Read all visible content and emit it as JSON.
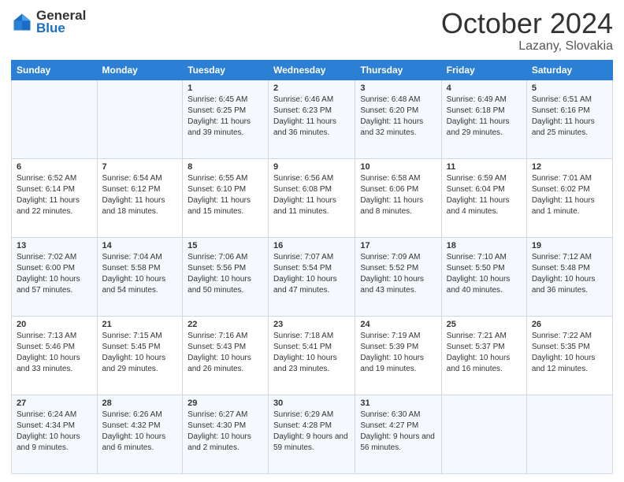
{
  "header": {
    "logo_general": "General",
    "logo_blue": "Blue",
    "month_title": "October 2024",
    "location": "Lazany, Slovakia"
  },
  "days_of_week": [
    "Sunday",
    "Monday",
    "Tuesday",
    "Wednesday",
    "Thursday",
    "Friday",
    "Saturday"
  ],
  "weeks": [
    [
      {
        "day": "",
        "sunrise": "",
        "sunset": "",
        "daylight": ""
      },
      {
        "day": "",
        "sunrise": "",
        "sunset": "",
        "daylight": ""
      },
      {
        "day": "1",
        "sunrise": "Sunrise: 6:45 AM",
        "sunset": "Sunset: 6:25 PM",
        "daylight": "Daylight: 11 hours and 39 minutes."
      },
      {
        "day": "2",
        "sunrise": "Sunrise: 6:46 AM",
        "sunset": "Sunset: 6:23 PM",
        "daylight": "Daylight: 11 hours and 36 minutes."
      },
      {
        "day": "3",
        "sunrise": "Sunrise: 6:48 AM",
        "sunset": "Sunset: 6:20 PM",
        "daylight": "Daylight: 11 hours and 32 minutes."
      },
      {
        "day": "4",
        "sunrise": "Sunrise: 6:49 AM",
        "sunset": "Sunset: 6:18 PM",
        "daylight": "Daylight: 11 hours and 29 minutes."
      },
      {
        "day": "5",
        "sunrise": "Sunrise: 6:51 AM",
        "sunset": "Sunset: 6:16 PM",
        "daylight": "Daylight: 11 hours and 25 minutes."
      }
    ],
    [
      {
        "day": "6",
        "sunrise": "Sunrise: 6:52 AM",
        "sunset": "Sunset: 6:14 PM",
        "daylight": "Daylight: 11 hours and 22 minutes."
      },
      {
        "day": "7",
        "sunrise": "Sunrise: 6:54 AM",
        "sunset": "Sunset: 6:12 PM",
        "daylight": "Daylight: 11 hours and 18 minutes."
      },
      {
        "day": "8",
        "sunrise": "Sunrise: 6:55 AM",
        "sunset": "Sunset: 6:10 PM",
        "daylight": "Daylight: 11 hours and 15 minutes."
      },
      {
        "day": "9",
        "sunrise": "Sunrise: 6:56 AM",
        "sunset": "Sunset: 6:08 PM",
        "daylight": "Daylight: 11 hours and 11 minutes."
      },
      {
        "day": "10",
        "sunrise": "Sunrise: 6:58 AM",
        "sunset": "Sunset: 6:06 PM",
        "daylight": "Daylight: 11 hours and 8 minutes."
      },
      {
        "day": "11",
        "sunrise": "Sunrise: 6:59 AM",
        "sunset": "Sunset: 6:04 PM",
        "daylight": "Daylight: 11 hours and 4 minutes."
      },
      {
        "day": "12",
        "sunrise": "Sunrise: 7:01 AM",
        "sunset": "Sunset: 6:02 PM",
        "daylight": "Daylight: 11 hours and 1 minute."
      }
    ],
    [
      {
        "day": "13",
        "sunrise": "Sunrise: 7:02 AM",
        "sunset": "Sunset: 6:00 PM",
        "daylight": "Daylight: 10 hours and 57 minutes."
      },
      {
        "day": "14",
        "sunrise": "Sunrise: 7:04 AM",
        "sunset": "Sunset: 5:58 PM",
        "daylight": "Daylight: 10 hours and 54 minutes."
      },
      {
        "day": "15",
        "sunrise": "Sunrise: 7:06 AM",
        "sunset": "Sunset: 5:56 PM",
        "daylight": "Daylight: 10 hours and 50 minutes."
      },
      {
        "day": "16",
        "sunrise": "Sunrise: 7:07 AM",
        "sunset": "Sunset: 5:54 PM",
        "daylight": "Daylight: 10 hours and 47 minutes."
      },
      {
        "day": "17",
        "sunrise": "Sunrise: 7:09 AM",
        "sunset": "Sunset: 5:52 PM",
        "daylight": "Daylight: 10 hours and 43 minutes."
      },
      {
        "day": "18",
        "sunrise": "Sunrise: 7:10 AM",
        "sunset": "Sunset: 5:50 PM",
        "daylight": "Daylight: 10 hours and 40 minutes."
      },
      {
        "day": "19",
        "sunrise": "Sunrise: 7:12 AM",
        "sunset": "Sunset: 5:48 PM",
        "daylight": "Daylight: 10 hours and 36 minutes."
      }
    ],
    [
      {
        "day": "20",
        "sunrise": "Sunrise: 7:13 AM",
        "sunset": "Sunset: 5:46 PM",
        "daylight": "Daylight: 10 hours and 33 minutes."
      },
      {
        "day": "21",
        "sunrise": "Sunrise: 7:15 AM",
        "sunset": "Sunset: 5:45 PM",
        "daylight": "Daylight: 10 hours and 29 minutes."
      },
      {
        "day": "22",
        "sunrise": "Sunrise: 7:16 AM",
        "sunset": "Sunset: 5:43 PM",
        "daylight": "Daylight: 10 hours and 26 minutes."
      },
      {
        "day": "23",
        "sunrise": "Sunrise: 7:18 AM",
        "sunset": "Sunset: 5:41 PM",
        "daylight": "Daylight: 10 hours and 23 minutes."
      },
      {
        "day": "24",
        "sunrise": "Sunrise: 7:19 AM",
        "sunset": "Sunset: 5:39 PM",
        "daylight": "Daylight: 10 hours and 19 minutes."
      },
      {
        "day": "25",
        "sunrise": "Sunrise: 7:21 AM",
        "sunset": "Sunset: 5:37 PM",
        "daylight": "Daylight: 10 hours and 16 minutes."
      },
      {
        "day": "26",
        "sunrise": "Sunrise: 7:22 AM",
        "sunset": "Sunset: 5:35 PM",
        "daylight": "Daylight: 10 hours and 12 minutes."
      }
    ],
    [
      {
        "day": "27",
        "sunrise": "Sunrise: 6:24 AM",
        "sunset": "Sunset: 4:34 PM",
        "daylight": "Daylight: 10 hours and 9 minutes."
      },
      {
        "day": "28",
        "sunrise": "Sunrise: 6:26 AM",
        "sunset": "Sunset: 4:32 PM",
        "daylight": "Daylight: 10 hours and 6 minutes."
      },
      {
        "day": "29",
        "sunrise": "Sunrise: 6:27 AM",
        "sunset": "Sunset: 4:30 PM",
        "daylight": "Daylight: 10 hours and 2 minutes."
      },
      {
        "day": "30",
        "sunrise": "Sunrise: 6:29 AM",
        "sunset": "Sunset: 4:28 PM",
        "daylight": "Daylight: 9 hours and 59 minutes."
      },
      {
        "day": "31",
        "sunrise": "Sunrise: 6:30 AM",
        "sunset": "Sunset: 4:27 PM",
        "daylight": "Daylight: 9 hours and 56 minutes."
      },
      {
        "day": "",
        "sunrise": "",
        "sunset": "",
        "daylight": ""
      },
      {
        "day": "",
        "sunrise": "",
        "sunset": "",
        "daylight": ""
      }
    ]
  ]
}
